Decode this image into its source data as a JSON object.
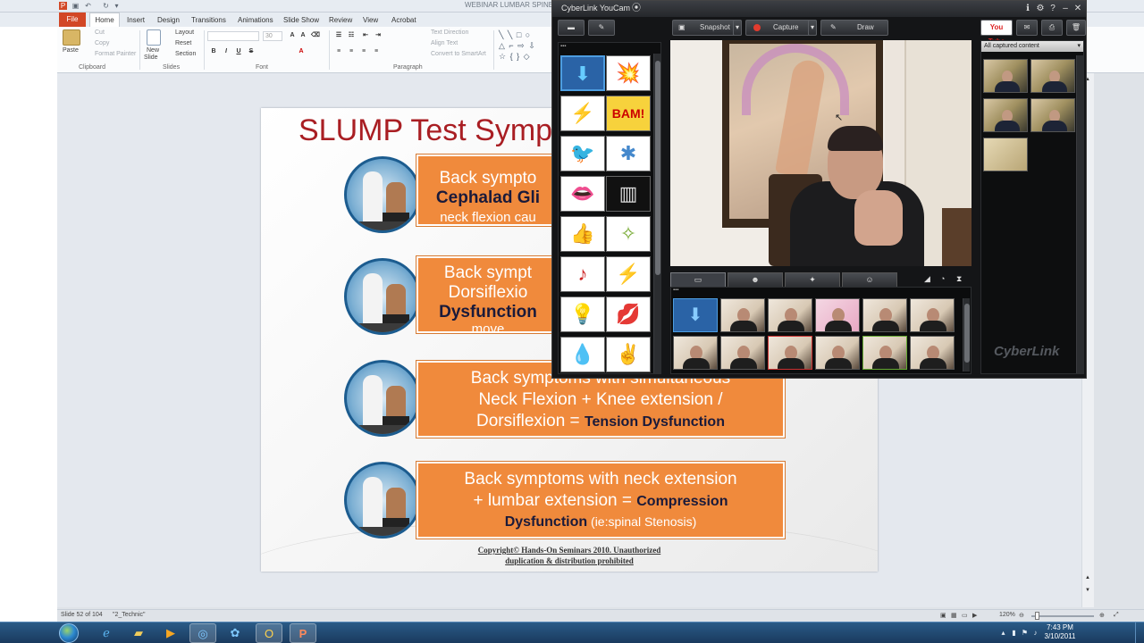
{
  "ppt": {
    "window_title": "WEBINAR LUMBAR SPINE.pptx",
    "tabs": [
      "File",
      "Home",
      "Insert",
      "Design",
      "Transitions",
      "Animations",
      "Slide Show",
      "Review",
      "View",
      "Acrobat"
    ],
    "clipboard": {
      "paste": "Paste",
      "cut": "Cut",
      "copy": "Copy",
      "format_painter": "Format Painter",
      "label": "Clipboard"
    },
    "slides": {
      "new_slide_line1": "New",
      "new_slide_line2": "Slide",
      "layout": "Layout",
      "reset": "Reset",
      "section": "Section",
      "label": "Slides"
    },
    "font": {
      "size": "30",
      "label": "Font"
    },
    "paragraph": {
      "text_direction": "Text Direction",
      "align_text": "Align Text",
      "convert_smartart": "Convert to SmartArt",
      "label": "Paragraph"
    }
  },
  "slide": {
    "title": "SLUMP Test Symp",
    "rows": [
      {
        "lines": [
          {
            "text": "Back sympto",
            "style": "normal"
          },
          {
            "text": "Cephalad Gli",
            "style": "dark"
          },
          {
            "text": "neck flexion cau",
            "style": "small"
          }
        ]
      },
      {
        "lines": [
          {
            "text": "Back sympt",
            "style": "normal"
          },
          {
            "text": "Dorsiflexio",
            "style": "normal"
          },
          {
            "text": "Dysfunction",
            "style": "dark"
          },
          {
            "text": "move",
            "style": "small"
          }
        ]
      },
      {
        "lines": [
          {
            "text": "Back symptoms with simultaneous",
            "style": "normal"
          },
          {
            "text": "Neck Flexion + Knee extension /",
            "style": "normal"
          },
          {
            "text": "Dorsiflexion = ",
            "style": "normal",
            "tail": "Tension Dysfunction"
          }
        ]
      },
      {
        "lines": [
          {
            "text": "Back symptoms with neck extension",
            "style": "normal"
          },
          {
            "text": "+ lumbar extension = ",
            "style": "normal",
            "tail": "Compression"
          },
          {
            "text": "Dysfunction",
            "style": "dark",
            "tail2": " (ie:spinal Stenosis)"
          }
        ]
      }
    ],
    "copyright_line1": "Copyright©  Hands-On Seminars 2010. Unauthorized",
    "copyright_line2": "duplication  & distribution  prohibited"
  },
  "status": {
    "slide_info": "Slide 52 of 104",
    "theme": "\"2_Technic\"",
    "zoom": "120%"
  },
  "youcam": {
    "title": "CyberLink YouCam",
    "snapshot": "Snapshot",
    "capture": "Capture",
    "draw": "Draw",
    "filter": "All captured content",
    "logo": "CyberLink",
    "youtube": "You Tube",
    "effects": [
      "⬇",
      "💥",
      "⚡",
      "BAM!",
      "🐦",
      "✱",
      "👄",
      "▥",
      "👍",
      "✧",
      "♪",
      "⚡",
      "💡",
      "💋",
      "💧",
      "✌"
    ]
  },
  "taskbar": {
    "time": "7:43 PM",
    "date": "3/10/2011"
  },
  "colors": {
    "accent_orange": "#f08a3c",
    "title_red": "#a91e23",
    "youcam_bg": "#141517"
  }
}
